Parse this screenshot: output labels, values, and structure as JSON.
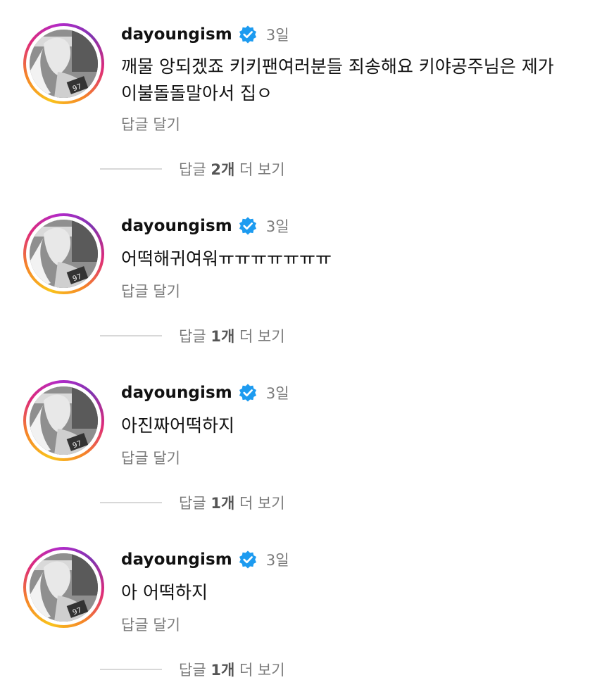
{
  "comments": [
    {
      "username": "dayoungism",
      "time": "3일",
      "text": "깨물 앙되겠죠 키키팬여러분들 죄송해요 키야공주님은 제가\n이불돌돌말아서 집ㅇ",
      "reply_label": "답글 달기",
      "view_prefix": "답글 ",
      "view_count": "2개",
      "view_suffix": " 더 보기"
    },
    {
      "username": "dayoungism",
      "time": "3일",
      "text": "어떡해귀여워ㅠㅠㅠㅠㅠㅠㅠ",
      "reply_label": "답글 달기",
      "view_prefix": "답글 ",
      "view_count": "1개",
      "view_suffix": " 더 보기"
    },
    {
      "username": "dayoungism",
      "time": "3일",
      "text": "아진짜어떡하지",
      "reply_label": "답글 달기",
      "view_prefix": "답글 ",
      "view_count": "1개",
      "view_suffix": " 더 보기"
    },
    {
      "username": "dayoungism",
      "time": "3일",
      "text": "아 어떡하지",
      "reply_label": "답글 달기",
      "view_prefix": "답글 ",
      "view_count": "1개",
      "view_suffix": " 더 보기"
    }
  ],
  "colors": {
    "verified": "#1d9bf0",
    "muted_text": "#7a7a7a",
    "divider": "#d8d8d8"
  },
  "icons": {
    "verified": "verified-badge-icon"
  }
}
